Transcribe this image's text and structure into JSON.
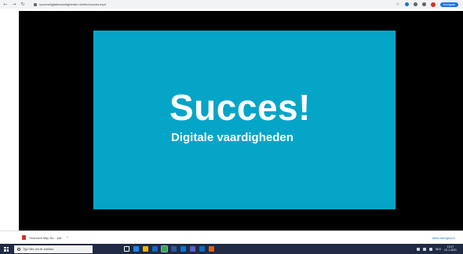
{
  "browser": {
    "url": "succesdigitalevaardigheden.nl/intro/succes.mp4",
    "continue_label": "Doorgaan"
  },
  "slide": {
    "title": "Succes!",
    "subtitle": "Digitale vaardigheden",
    "background": "#05a5c8"
  },
  "download_bar": {
    "file_name": "Overzicht Mijn Su....pdf",
    "show_all_label": "Alles weergeven"
  },
  "taskbar": {
    "search_placeholder": "Typ hier om te zoeken",
    "apps": [
      {
        "name": "task-view-icon",
        "color": "#ffffff"
      },
      {
        "name": "edge-icon",
        "color": "#1e88e5"
      },
      {
        "name": "file-explorer-icon",
        "color": "#f4b400"
      },
      {
        "name": "mail-icon",
        "color": "#1565c0"
      },
      {
        "name": "chrome-icon",
        "color": "#34a853"
      },
      {
        "name": "word-icon",
        "color": "#2b579a"
      },
      {
        "name": "outlook-icon",
        "color": "#0078d4"
      },
      {
        "name": "teams-icon",
        "color": "#5b5fc7"
      },
      {
        "name": "onedrive-icon",
        "color": "#0f6cbd"
      },
      {
        "name": "firefox-icon",
        "color": "#e66000"
      }
    ],
    "language": "NLD",
    "time": "13:17",
    "date": "12-1-2021"
  }
}
